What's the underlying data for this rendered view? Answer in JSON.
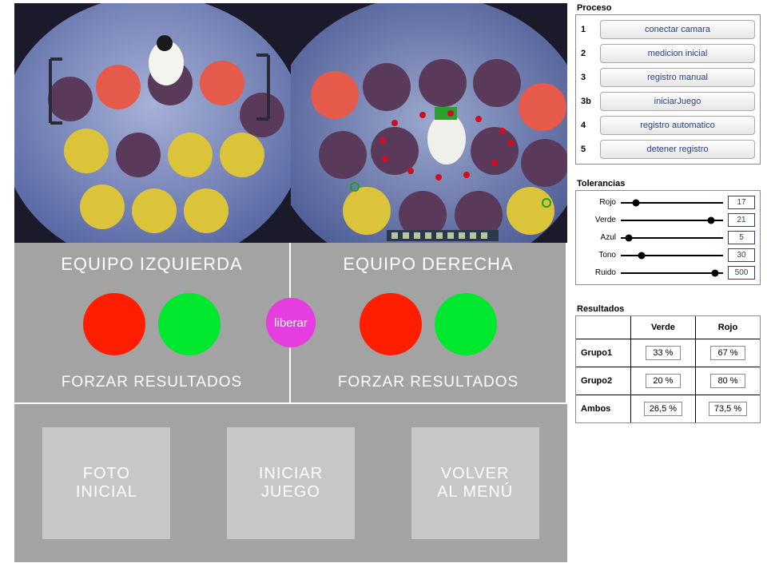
{
  "teams": {
    "left": {
      "title": "EQUIPO IZQUIERDA",
      "footer": "FORZAR RESULTADOS"
    },
    "right": {
      "title": "EQUIPO DERECHA",
      "footer": "FORZAR RESULTADOS"
    },
    "liberar": "liberar"
  },
  "buttons": {
    "foto": "FOTO\nINICIAL",
    "iniciar": "INICIAR\nJUEGO",
    "volver": "VOLVER\nAL MENÚ"
  },
  "proceso": {
    "title": "Proceso",
    "steps": [
      {
        "num": "1",
        "label": "conectar camara"
      },
      {
        "num": "2",
        "label": "medicion inicial"
      },
      {
        "num": "3",
        "label": "registro manual"
      },
      {
        "num": "3b",
        "label": "iniciarJuego"
      },
      {
        "num": "4",
        "label": "registro automatico"
      },
      {
        "num": "5",
        "label": "detener registro"
      }
    ]
  },
  "tolerancias": {
    "title": "Tolerancias",
    "items": [
      {
        "label": "Rojo",
        "value": "17",
        "pos": 0.15
      },
      {
        "label": "Verde",
        "value": "21",
        "pos": 0.88
      },
      {
        "label": "Azul",
        "value": "5",
        "pos": 0.08
      },
      {
        "label": "Tono",
        "value": "30",
        "pos": 0.2
      },
      {
        "label": "Ruido",
        "value": "500",
        "pos": 0.92
      }
    ]
  },
  "resultados": {
    "title": "Resultados",
    "headers": {
      "col1": "Verde",
      "col2": "Rojo"
    },
    "rows": [
      {
        "label": "Grupo1",
        "verde": "33 %",
        "rojo": "67 %"
      },
      {
        "label": "Grupo2",
        "verde": "20 %",
        "rojo": "80 %"
      },
      {
        "label": "Ambos",
        "verde": "26,5 %",
        "rojo": "73,5 %"
      }
    ]
  }
}
